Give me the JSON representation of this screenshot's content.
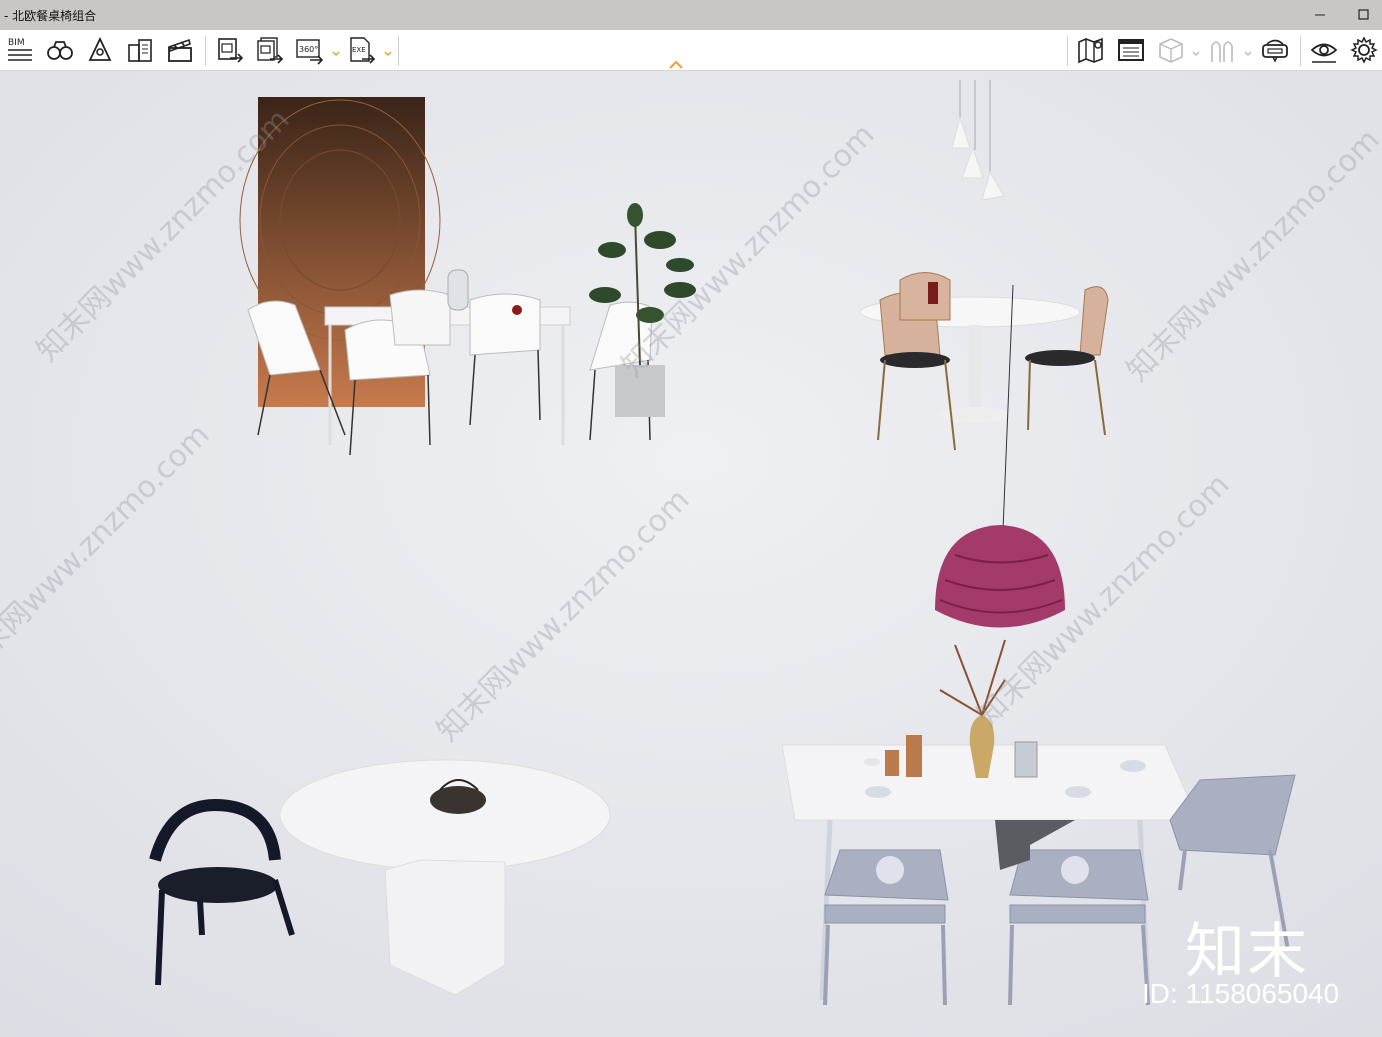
{
  "window": {
    "title": "- 北欧餐桌椅组合",
    "minimize_icon": "minimize-icon",
    "maximize_icon": "maximize-icon"
  },
  "toolbar": {
    "menu_label": "BIM",
    "left_tools": [
      "binoculars-icon",
      "pen-tool-icon",
      "buildings-icon",
      "clapperboard-icon"
    ],
    "export_tools": [
      "export-image-icon",
      "export-batch-icon",
      "export-360-icon",
      "export-exe-icon"
    ],
    "export_360_label": "360°",
    "export_exe_label": "EXE",
    "right_tools": [
      "map-icon",
      "floorplan-icon",
      "cube-view-icon",
      "people-icon",
      "vr-headset-icon",
      "eye-view-icon",
      "settings-icon"
    ],
    "accent_color": "#f0a030"
  },
  "viewport": {
    "watermark": "知末网www.znzmo.com",
    "logo": "知末",
    "id_label": "ID: 1158065040"
  }
}
